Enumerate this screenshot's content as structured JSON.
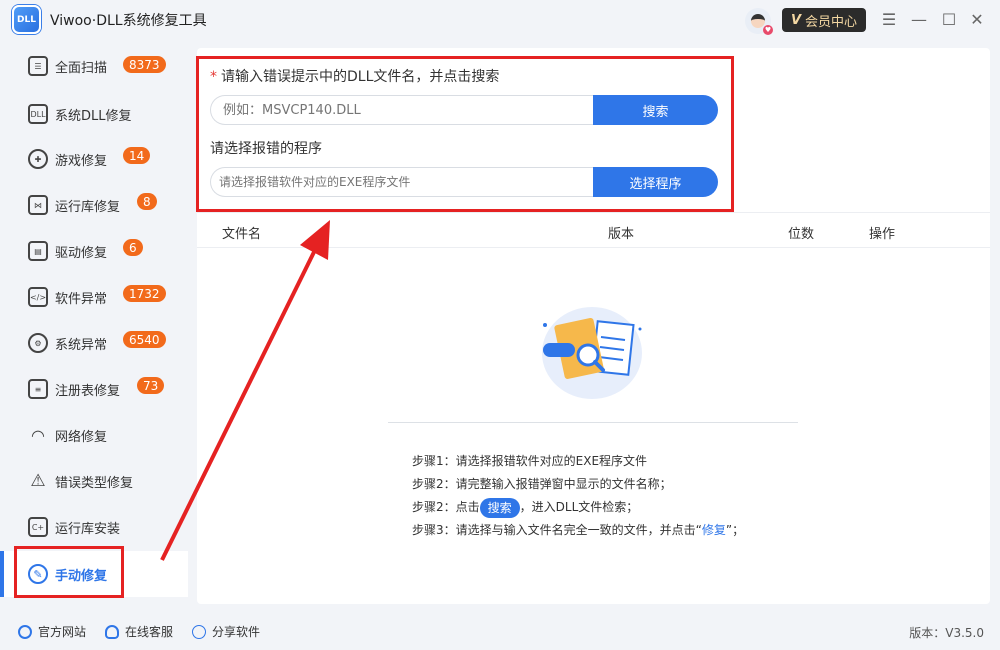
{
  "app": {
    "logo_text": "DLL",
    "title": "Viwoo·DLL系统修复工具",
    "vip_icon": "V",
    "vip_label": "会员中心"
  },
  "window_controls": {
    "menu": "☰",
    "minimize": "—",
    "maximize": "☐",
    "close": "✕"
  },
  "sidebar": {
    "items": [
      {
        "label": "全面扫描",
        "badge": "8373",
        "icon": "scan-icon"
      },
      {
        "label": "系统DLL修复",
        "badge": "",
        "icon": "dll-icon"
      },
      {
        "label": "游戏修复",
        "badge": "14",
        "icon": "gamepad-icon"
      },
      {
        "label": "运行库修复",
        "badge": "8",
        "icon": "vs-icon"
      },
      {
        "label": "驱动修复",
        "badge": "6",
        "icon": "driver-icon"
      },
      {
        "label": "软件异常",
        "badge": "1732",
        "icon": "code-icon"
      },
      {
        "label": "系统异常",
        "badge": "6540",
        "icon": "gear-icon"
      },
      {
        "label": "注册表修复",
        "badge": "73",
        "icon": "list-icon"
      },
      {
        "label": "网络修复",
        "badge": "",
        "icon": "wifi-icon"
      },
      {
        "label": "错误类型修复",
        "badge": "",
        "icon": "warning-icon"
      },
      {
        "label": "运行库安装",
        "badge": "",
        "icon": "cpp-icon"
      },
      {
        "label": "手动修复",
        "badge": "",
        "icon": "wrench-icon"
      }
    ]
  },
  "main": {
    "required_mark": "*",
    "dll_label": "请输入错误提示中的DLL文件名，并点击搜索",
    "dll_placeholder": "例如：MSVCP140.DLL",
    "search_button": "搜索",
    "program_label": "请选择报错的程序",
    "program_placeholder": "请选择报错软件对应的EXE程序文件",
    "select_program_button": "选择程序",
    "table_headers": [
      "文件名",
      "版本",
      "位数",
      "操作"
    ],
    "steps": {
      "s1": "步骤1：请选择报错软件对应的EXE程序文件",
      "s2": "步骤2：请完整输入报错弹窗中显示的文件名称；",
      "s3_prefix": "步骤2：点击",
      "s3_pill": "搜索",
      "s3_suffix": "，进入DLL文件检索；",
      "s4_prefix": "步骤3：请选择与输入文件名完全一致的文件，并点击“",
      "s4_link": "修复",
      "s4_suffix": "”；"
    }
  },
  "footer": {
    "website": "官方网站",
    "support": "在线客服",
    "share": "分享软件",
    "version": "版本：V3.5.0"
  },
  "colors": {
    "accent": "#2f76e8",
    "badge": "#f26a1b",
    "highlight": "#e52222"
  }
}
